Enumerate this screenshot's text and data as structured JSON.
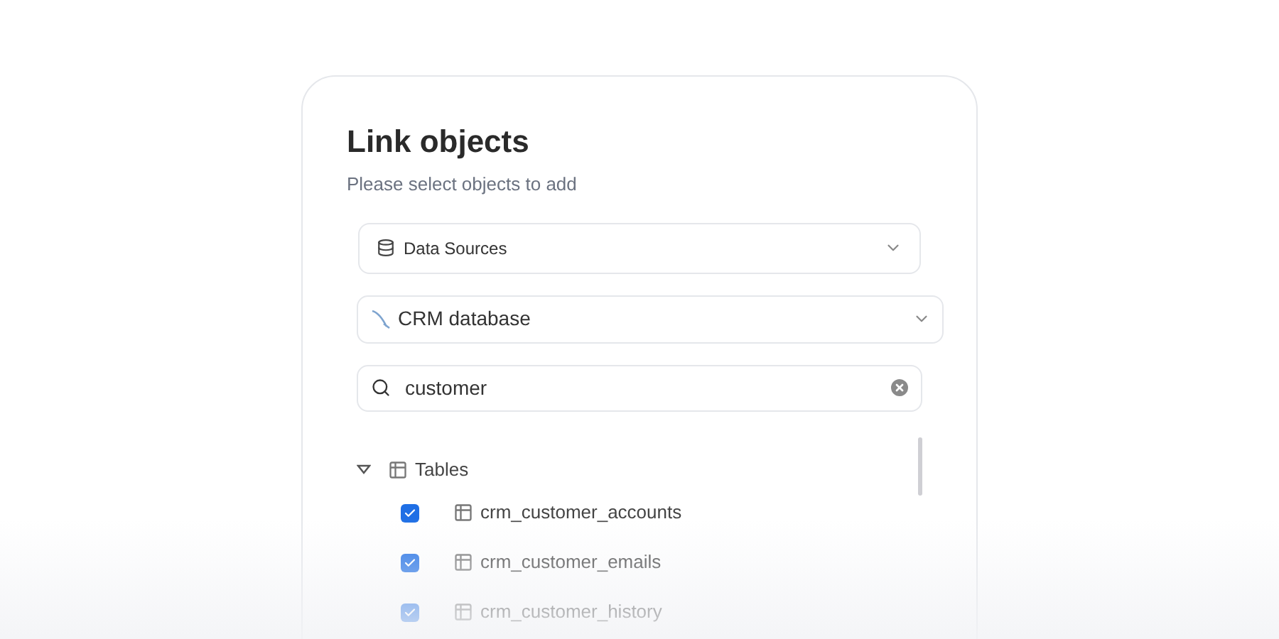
{
  "dialog": {
    "title": "Link objects",
    "subtitle": "Please select objects to add"
  },
  "source_select": {
    "value": "Data Sources"
  },
  "database_select": {
    "value": "CRM database"
  },
  "search": {
    "value": "customer"
  },
  "tree": {
    "label": "Tables",
    "expanded": true,
    "children": [
      {
        "label": "crm_customer_accounts",
        "checked": true
      },
      {
        "label": "crm_customer_emails",
        "checked": true
      },
      {
        "label": "crm_customer_history",
        "checked": true
      }
    ]
  }
}
